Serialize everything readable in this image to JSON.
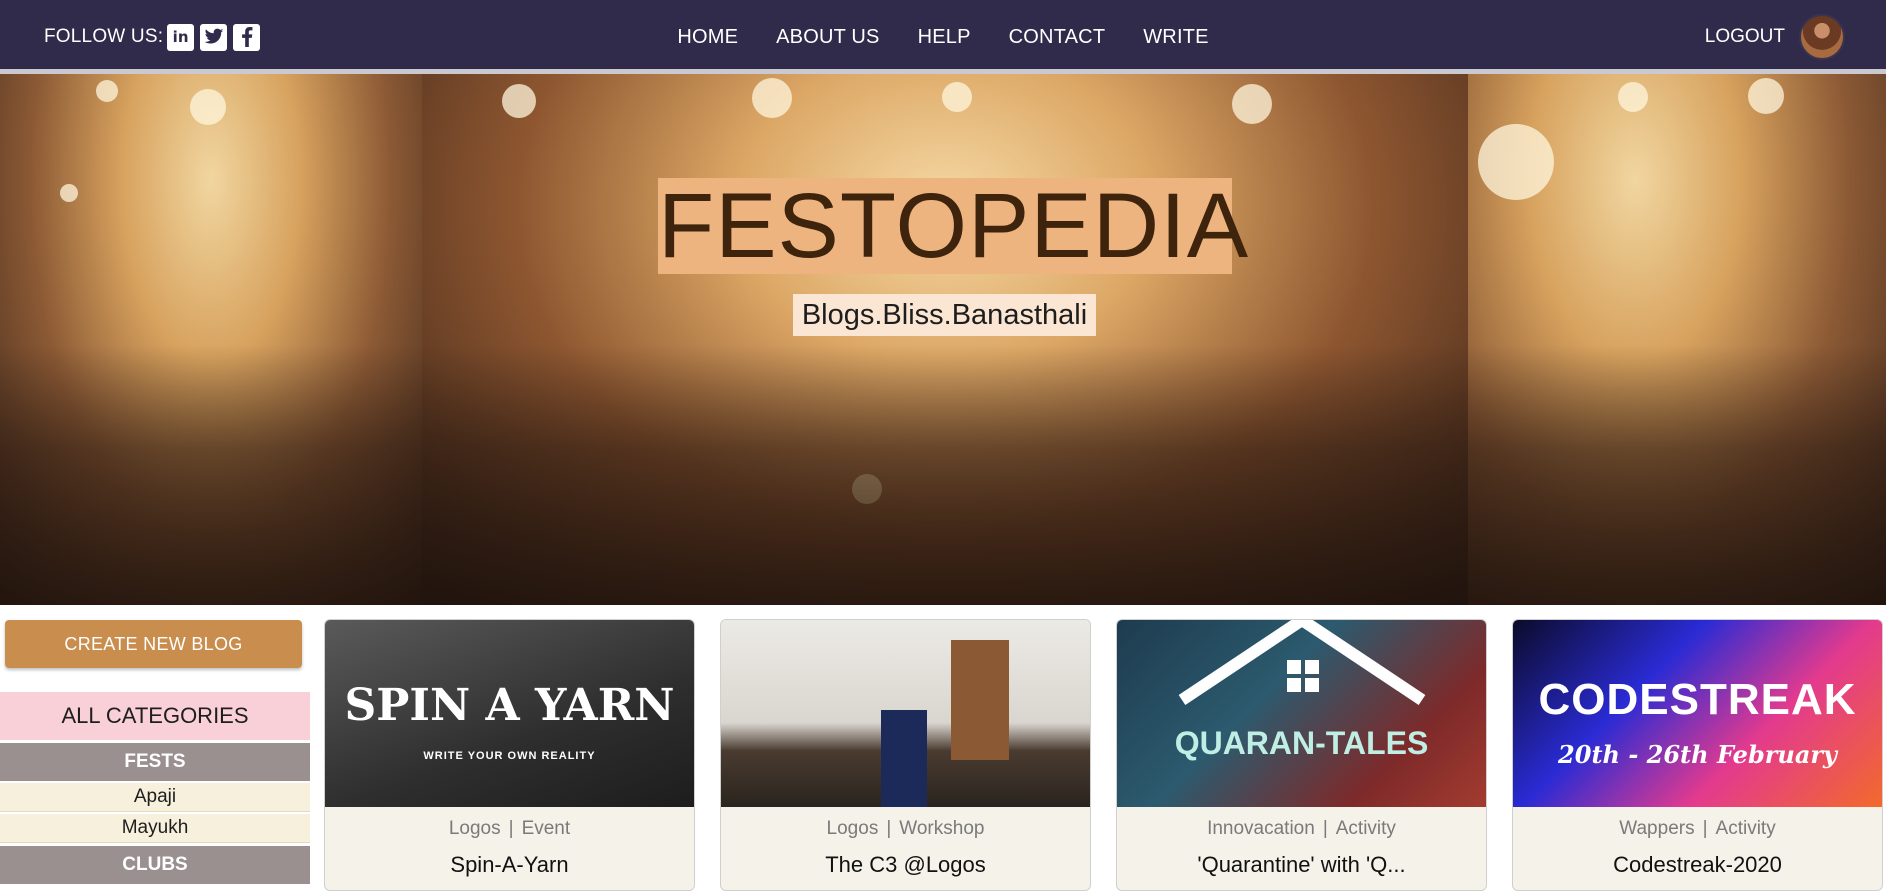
{
  "header": {
    "follow_label": "FOLLOW US:",
    "social": [
      {
        "icon": "linkedin-icon",
        "glyph": "in"
      },
      {
        "icon": "twitter-icon"
      },
      {
        "icon": "facebook-icon"
      }
    ],
    "nav": [
      "HOME",
      "ABOUT US",
      "HELP",
      "CONTACT",
      "WRITE"
    ],
    "logout_label": "LOGOUT"
  },
  "hero": {
    "title": "FESTOPEDIA",
    "subtitle": "Blogs.Bliss.Banasthali"
  },
  "sidebar": {
    "create_button": "CREATE NEW BLOG",
    "categories_title": "ALL CATEGORIES",
    "groups": [
      {
        "name": "FESTS",
        "items": [
          "Apaji",
          "Mayukh"
        ]
      },
      {
        "name": "CLUBS",
        "items": []
      }
    ]
  },
  "cards": [
    {
      "club": "Logos",
      "type": "Event",
      "title": "Spin-A-Yarn",
      "thumb_text": "SPIN A YARN",
      "thumb_sub": "WRITE YOUR OWN REALITY"
    },
    {
      "club": "Logos",
      "type": "Workshop",
      "title": "The C3 @Logos",
      "thumb_text": "",
      "thumb_sub": ""
    },
    {
      "club": "Innovacation",
      "type": "Activity",
      "title": "'Quarantine' with 'Q...",
      "thumb_text": "QUARAN-TALES",
      "thumb_sub": ""
    },
    {
      "club": "Wappers",
      "type": "Activity",
      "title": "Codestreak-2020",
      "thumb_text": "CODESTREAK",
      "thumb_sub": "20th - 26th February"
    }
  ],
  "colors": {
    "topbar": "#302a4b",
    "hero_title_bg": "#eeb480",
    "create_button": "#c98d4e",
    "categories_head": "#f9cfd8",
    "category_group": "#9a9090"
  }
}
